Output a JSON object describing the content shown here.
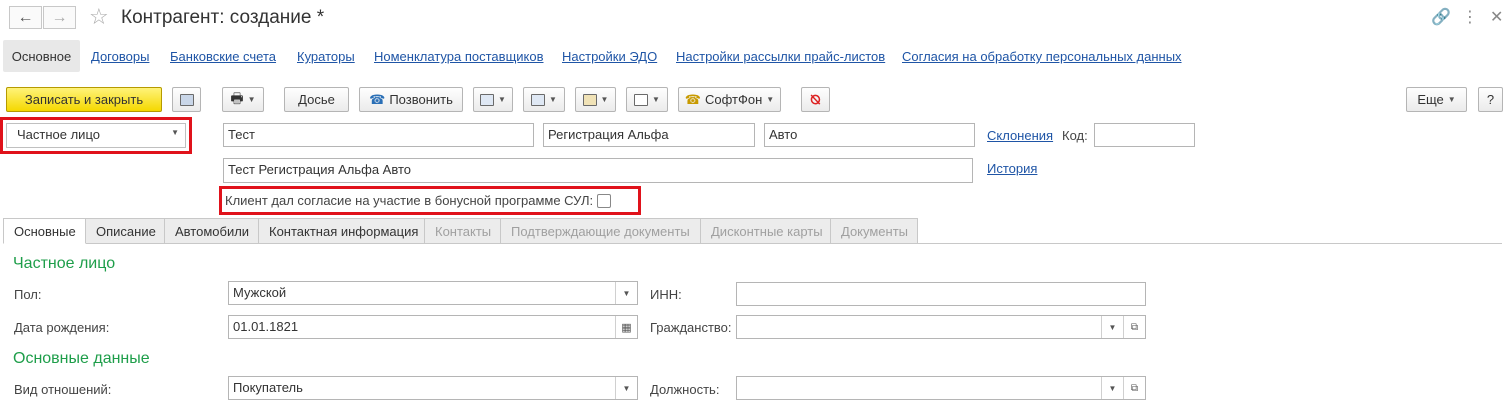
{
  "window": {
    "title": "Контрагент: создание *"
  },
  "tabs": [
    "Основное",
    "Договоры",
    "Банковские счета",
    "Кураторы",
    "Номенклатура поставщиков",
    "Настройки ЭДО",
    "Настройки рассылки прайс-листов",
    "Согласия на обработку персональных данных"
  ],
  "toolbar": {
    "save_close": "Записать и закрыть",
    "dossier": "Досье",
    "call": "Позвонить",
    "softphone": "СофтФон",
    "more": "Еще",
    "help": "?"
  },
  "form": {
    "type": "Частное лицо",
    "last_name": "Тест",
    "first_name": "Регистрация Альфа",
    "middle_name": "Авто",
    "declensions_link": "Склонения",
    "code_label": "Код:",
    "code_value": "",
    "full_name": "Тест Регистрация Альфа Авто",
    "history_link": "История",
    "consent_label": "Клиент дал согласие на участие в бонусной программе СУЛ:"
  },
  "subtabs": [
    {
      "label": "Основные",
      "disabled": false
    },
    {
      "label": "Описание",
      "disabled": false
    },
    {
      "label": "Автомобили",
      "disabled": false
    },
    {
      "label": "Контактная информация",
      "disabled": false
    },
    {
      "label": "Контакты",
      "disabled": true
    },
    {
      "label": "Подтверждающие документы",
      "disabled": true
    },
    {
      "label": "Дисконтные карты",
      "disabled": true
    },
    {
      "label": "Документы",
      "disabled": true
    }
  ],
  "details": {
    "section_person": "Частное лицо",
    "gender_label": "Пол:",
    "gender_value": "Мужской",
    "inn_label": "ИНН:",
    "inn_value": "",
    "birthdate_label": "Дата рождения:",
    "birthdate_value": "01.01.1821",
    "citizenship_label": "Гражданство:",
    "citizenship_value": "",
    "section_main": "Основные данные",
    "relation_label": "Вид отношений:",
    "relation_value": "Покупатель",
    "position_label": "Должность:",
    "position_value": ""
  }
}
